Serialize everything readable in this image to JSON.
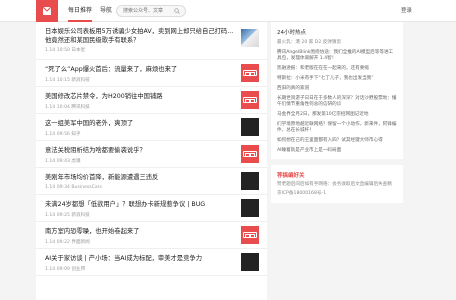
{
  "header": {
    "nav": [
      "每日推荐",
      "导航"
    ],
    "search_placeholder": "搜索公众号、文章",
    "login": "登录"
  },
  "feed": {
    "items": [
      {
        "title": "日本娱乐公司表板用5万诱骗少女拍AV，卖到网上却只给自己打码...他竟然还和某国民级歌手有联系？",
        "meta": "1.14 10:50 日本星",
        "thumb": "pic"
      },
      {
        "title": "“死了么”App爆火首后：流量来了，麻烦也来了",
        "meta": "1.14 10:15 新浪科技",
        "thumb": "red"
      },
      {
        "title": "美国修改芯片禁令，为H200销往中国铺路",
        "meta": "1.14 10:04 腾讯科技",
        "thumb": "red"
      },
      {
        "title": "这一组美军中国的老外，爽顶了",
        "meta": "1.14 09:56 知乎",
        "thumb": "dark"
      },
      {
        "title": "意法关税阻析结为啥都要偷袭说乎？",
        "meta": "1.14 09:43 虎嗅",
        "thumb": "red"
      },
      {
        "title": "美刚年市场均价首降，新能源遭遇三违反",
        "meta": "1.14 09:34 BusinessCars",
        "thumb": "dark"
      },
      {
        "title": "未满24岁都想「低欲用户」？联想办卡新规惹争议 | BUG",
        "meta": "1.14 09:25 新浪科技",
        "thumb": "dark"
      },
      {
        "title": "南方室内恐零噪，也开始卷起来了",
        "meta": "1.14 09:22 界面新闻",
        "thumb": "red"
      },
      {
        "title": "AI关于家访谈 | 产小场：当AI成为标配，审美才是竞争力",
        "meta": "1.14 09:09 创业邦",
        "thumb": "dark"
      }
    ]
  },
  "sidebar": {
    "title": "24小时热点",
    "lines": [
      "最火乳：港 20 家 D2 反弹猜思",
      "腾讯AngelBlink围绕协途：我们全推的AI模型后等等进工具包，发理体裁解开 1.4智！",
      "凯融逊报：和老版在在在一起来的，还有要缩",
      "特斯拉：小米有手下“七丁儿子，我也出发当我”",
      "西旧的真的家道",
      "长期世资游子日日在于多数人的深深？对话沙野股票地：懂午们情节重角性何总的信研的诊",
      "马金界全月2日，那发第10亿宗招网图记近地",
      "们学境原地越近联网络？保留一个小动作，新来件，阿锋编件，总在长城杆！",
      "如何想在己的王里面都有入四？试其经键大师市心得",
      "AI睡着就是产业市上是一码局面"
    ],
    "box2_title": "荐搞编好关",
    "box2_lines": [
      "赞老题后间后如有手网络：会务收取后文直编辑后失查精",
      "京ICP备18000168号-1"
    ]
  },
  "colors": {
    "accent": "#e84c4c"
  }
}
